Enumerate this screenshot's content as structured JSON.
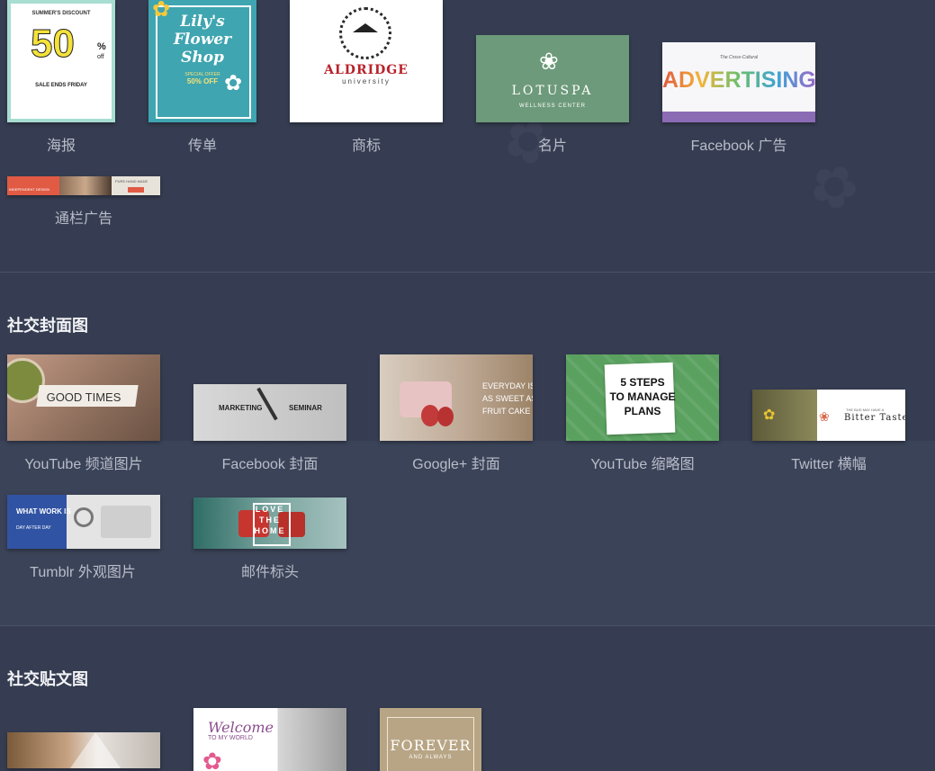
{
  "print_section": {
    "items": [
      {
        "caption": "海报",
        "thumb_lines": [
          "SUMMER'S DISCOUNT",
          "50",
          "%",
          "off",
          "SALE ENDS FRIDAY"
        ]
      },
      {
        "caption": "传单",
        "thumb_lines": [
          "Lily's",
          "Flower",
          "Shop",
          "SPECIAL OFFER",
          "50% OFF"
        ]
      },
      {
        "caption": "商标",
        "thumb_lines": [
          "ALDRIDGE",
          "university"
        ]
      },
      {
        "caption": "名片",
        "thumb_lines": [
          "LOTUSPA",
          "WELLNESS CENTER"
        ]
      },
      {
        "caption": "Facebook 广告",
        "thumb_lines": [
          "The Cross-Cultural",
          "ADVERTISING"
        ]
      },
      {
        "caption": "通栏广告",
        "thumb_lines": [
          "INDEPENDENT DESIGN",
          "PURE HAND MADE"
        ]
      }
    ]
  },
  "social_cover": {
    "title": "社交封面图",
    "items": [
      {
        "caption": "YouTube 频道图片",
        "thumb_lines": [
          "GOOD TIMES"
        ]
      },
      {
        "caption": "Facebook 封面",
        "thumb_lines": [
          "MARKETING",
          "SEMINAR"
        ]
      },
      {
        "caption": "Google+ 封面",
        "thumb_lines": [
          "EVERYDAY IS",
          "AS SWEET AS",
          "FRUIT CAKE"
        ]
      },
      {
        "caption": "YouTube 缩略图",
        "thumb_lines": [
          "5 STEPS",
          "TO MANAGE",
          "PLANS"
        ]
      },
      {
        "caption": "Twitter 横幅",
        "thumb_lines": [
          "THE BUD MAY HAVE A",
          "Bitter Taste"
        ]
      },
      {
        "caption": "Tumblr 外观图片",
        "thumb_lines": [
          "WHAT WORK IS",
          "DAY AFTER DAY"
        ]
      },
      {
        "caption": "邮件标头",
        "thumb_lines": [
          "LOVE",
          "THE",
          "HOME"
        ]
      }
    ]
  },
  "social_post": {
    "title": "社交贴文图",
    "items": [
      {
        "thumb_lines": []
      },
      {
        "thumb_lines": [
          "Welcome",
          "TO MY WORLD"
        ]
      },
      {
        "thumb_lines": [
          "FOREVER",
          "AND ALWAYS"
        ]
      }
    ]
  },
  "colors": {
    "background": "#363d52",
    "divider": "#4a5168"
  }
}
